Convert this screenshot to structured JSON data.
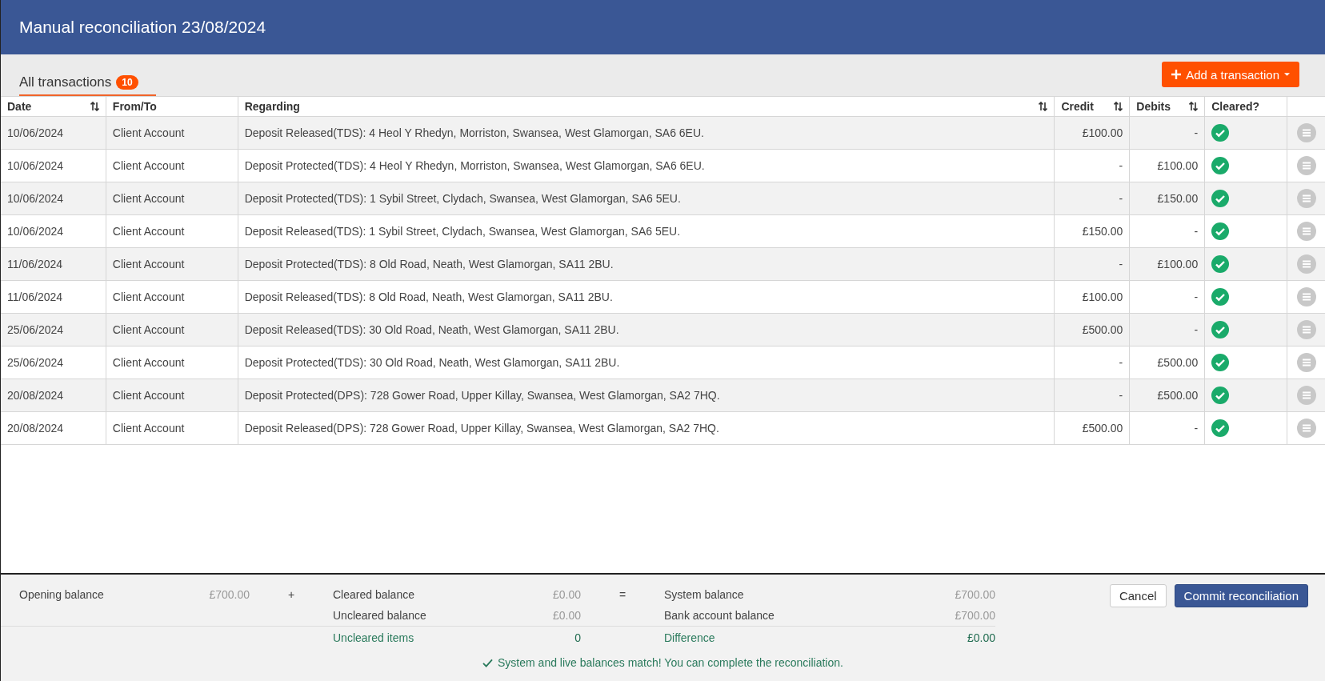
{
  "window": {
    "title": "Manual reconciliation 23/08/2024"
  },
  "tabs": [
    {
      "label": "All transactions",
      "count": "10",
      "selected": true
    }
  ],
  "add_button": {
    "label": "Add a transaction"
  },
  "table": {
    "columns": [
      {
        "label": "Date",
        "sortable": true
      },
      {
        "label": "From/To",
        "sortable": false
      },
      {
        "label": "Regarding",
        "sortable": true
      },
      {
        "label": "Credit",
        "sortable": true
      },
      {
        "label": "Debits",
        "sortable": true
      },
      {
        "label": "Cleared?",
        "sortable": false
      }
    ],
    "rows": [
      {
        "date": "10/06/2024",
        "from_to": "Client Account",
        "regarding": "Deposit Released(TDS): 4 Heol Y Rhedyn, Morriston, Swansea, West Glamorgan, SA6 6EU.",
        "credit": "£100.00",
        "debits": "-",
        "cleared": true
      },
      {
        "date": "10/06/2024",
        "from_to": "Client Account",
        "regarding": "Deposit Protected(TDS): 4 Heol Y Rhedyn, Morriston, Swansea, West Glamorgan, SA6 6EU.",
        "credit": "-",
        "debits": "£100.00",
        "cleared": true
      },
      {
        "date": "10/06/2024",
        "from_to": "Client Account",
        "regarding": "Deposit Protected(TDS): 1 Sybil Street, Clydach, Swansea, West Glamorgan, SA6 5EU.",
        "credit": "-",
        "debits": "£150.00",
        "cleared": true
      },
      {
        "date": "10/06/2024",
        "from_to": "Client Account",
        "regarding": "Deposit Released(TDS): 1 Sybil Street, Clydach, Swansea, West Glamorgan, SA6 5EU.",
        "credit": "£150.00",
        "debits": "-",
        "cleared": true
      },
      {
        "date": "11/06/2024",
        "from_to": "Client Account",
        "regarding": "Deposit Protected(TDS): 8 Old Road, Neath, West Glamorgan, SA11 2BU.",
        "credit": "-",
        "debits": "£100.00",
        "cleared": true
      },
      {
        "date": "11/06/2024",
        "from_to": "Client Account",
        "regarding": "Deposit Released(TDS): 8 Old Road, Neath, West Glamorgan, SA11 2BU.",
        "credit": "£100.00",
        "debits": "-",
        "cleared": true
      },
      {
        "date": "25/06/2024",
        "from_to": "Client Account",
        "regarding": "Deposit Released(TDS): 30 Old Road, Neath, West Glamorgan, SA11 2BU.",
        "credit": "£500.00",
        "debits": "-",
        "cleared": true
      },
      {
        "date": "25/06/2024",
        "from_to": "Client Account",
        "regarding": "Deposit Protected(TDS): 30 Old Road, Neath, West Glamorgan, SA11 2BU.",
        "credit": "-",
        "debits": "£500.00",
        "cleared": true
      },
      {
        "date": "20/08/2024",
        "from_to": "Client Account",
        "regarding": "Deposit Protected(DPS): 728 Gower Road, Upper Killay, Swansea, West Glamorgan, SA2 7HQ.",
        "credit": "-",
        "debits": "£500.00",
        "cleared": true
      },
      {
        "date": "20/08/2024",
        "from_to": "Client Account",
        "regarding": "Deposit Released(DPS): 728 Gower Road, Upper Killay, Swansea, West Glamorgan, SA2 7HQ.",
        "credit": "£500.00",
        "debits": "-",
        "cleared": true
      }
    ]
  },
  "footer": {
    "opening_balance": {
      "label": "Opening balance",
      "value": "£700.00"
    },
    "plus": "+",
    "cleared_balance": {
      "label": "Cleared balance",
      "value": "£0.00"
    },
    "uncleared_balance": {
      "label": "Uncleared balance",
      "value": "£0.00"
    },
    "equals": "=",
    "system_balance": {
      "label": "System balance",
      "value": "£700.00"
    },
    "bank_account_balance": {
      "label": "Bank account balance",
      "value": "£700.00"
    },
    "uncleared_items": {
      "label": "Uncleared items",
      "value": "0"
    },
    "difference": {
      "label": "Difference",
      "value": "£0.00"
    },
    "message": "System and live balances match! You can complete the reconciliation.",
    "buttons": [
      {
        "label": "Cancel",
        "kind": "secondary"
      },
      {
        "label": "Commit reconciliation",
        "kind": "primary"
      }
    ]
  }
}
